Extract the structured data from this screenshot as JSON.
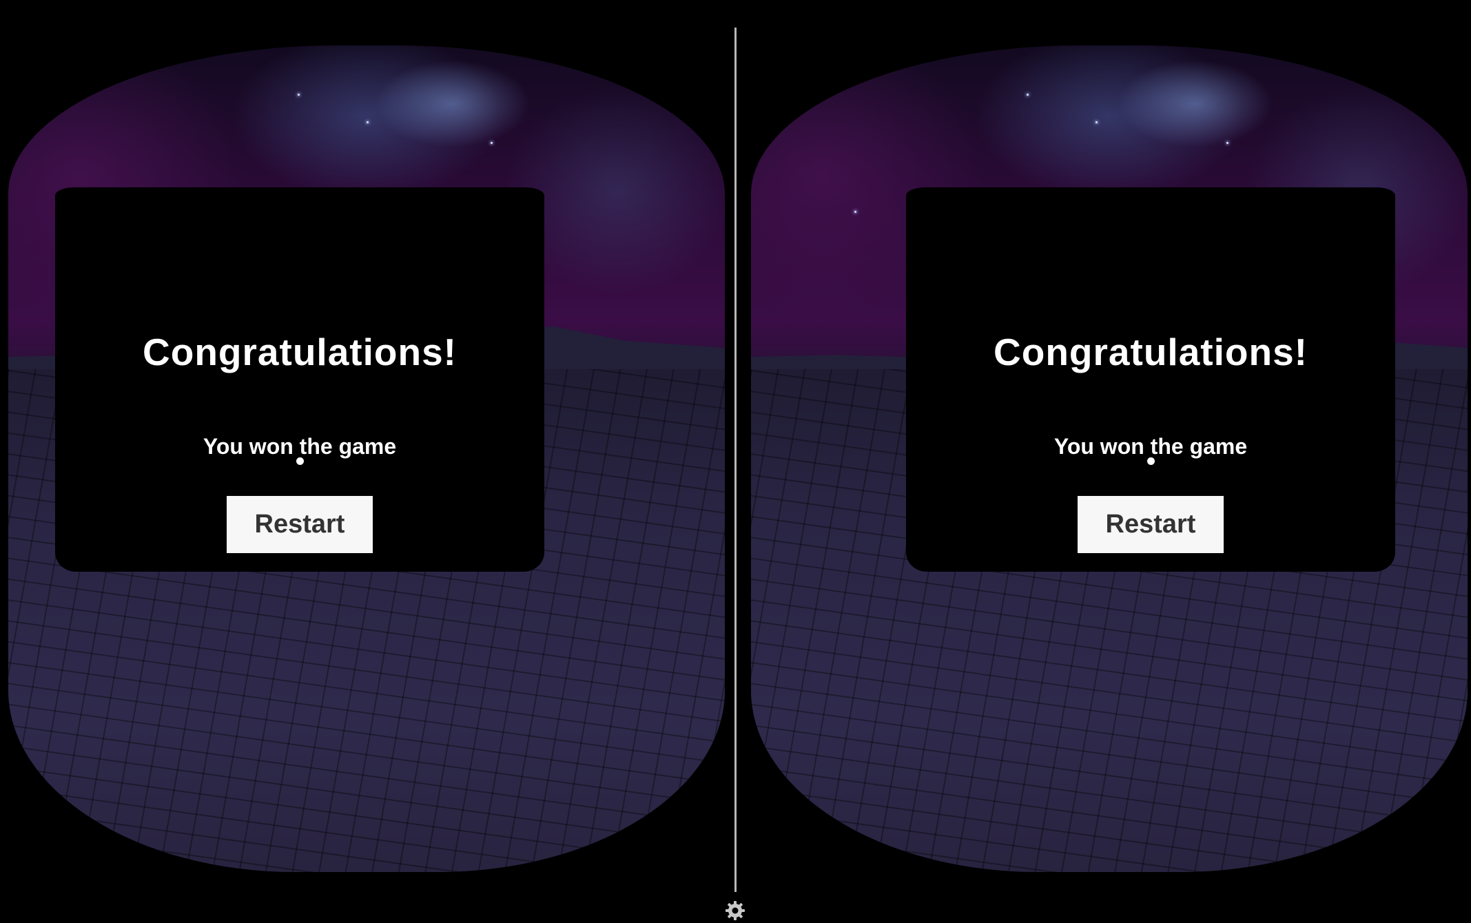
{
  "dialog": {
    "title": "Congratulations!",
    "message": "You won the game",
    "restart_label": "Restart"
  },
  "controls": {
    "settings_icon": "gear-icon"
  },
  "colors": {
    "panel": "#000000",
    "button": "#f7f7f7",
    "button_text": "#333333",
    "divider": "#b8b8b8"
  }
}
